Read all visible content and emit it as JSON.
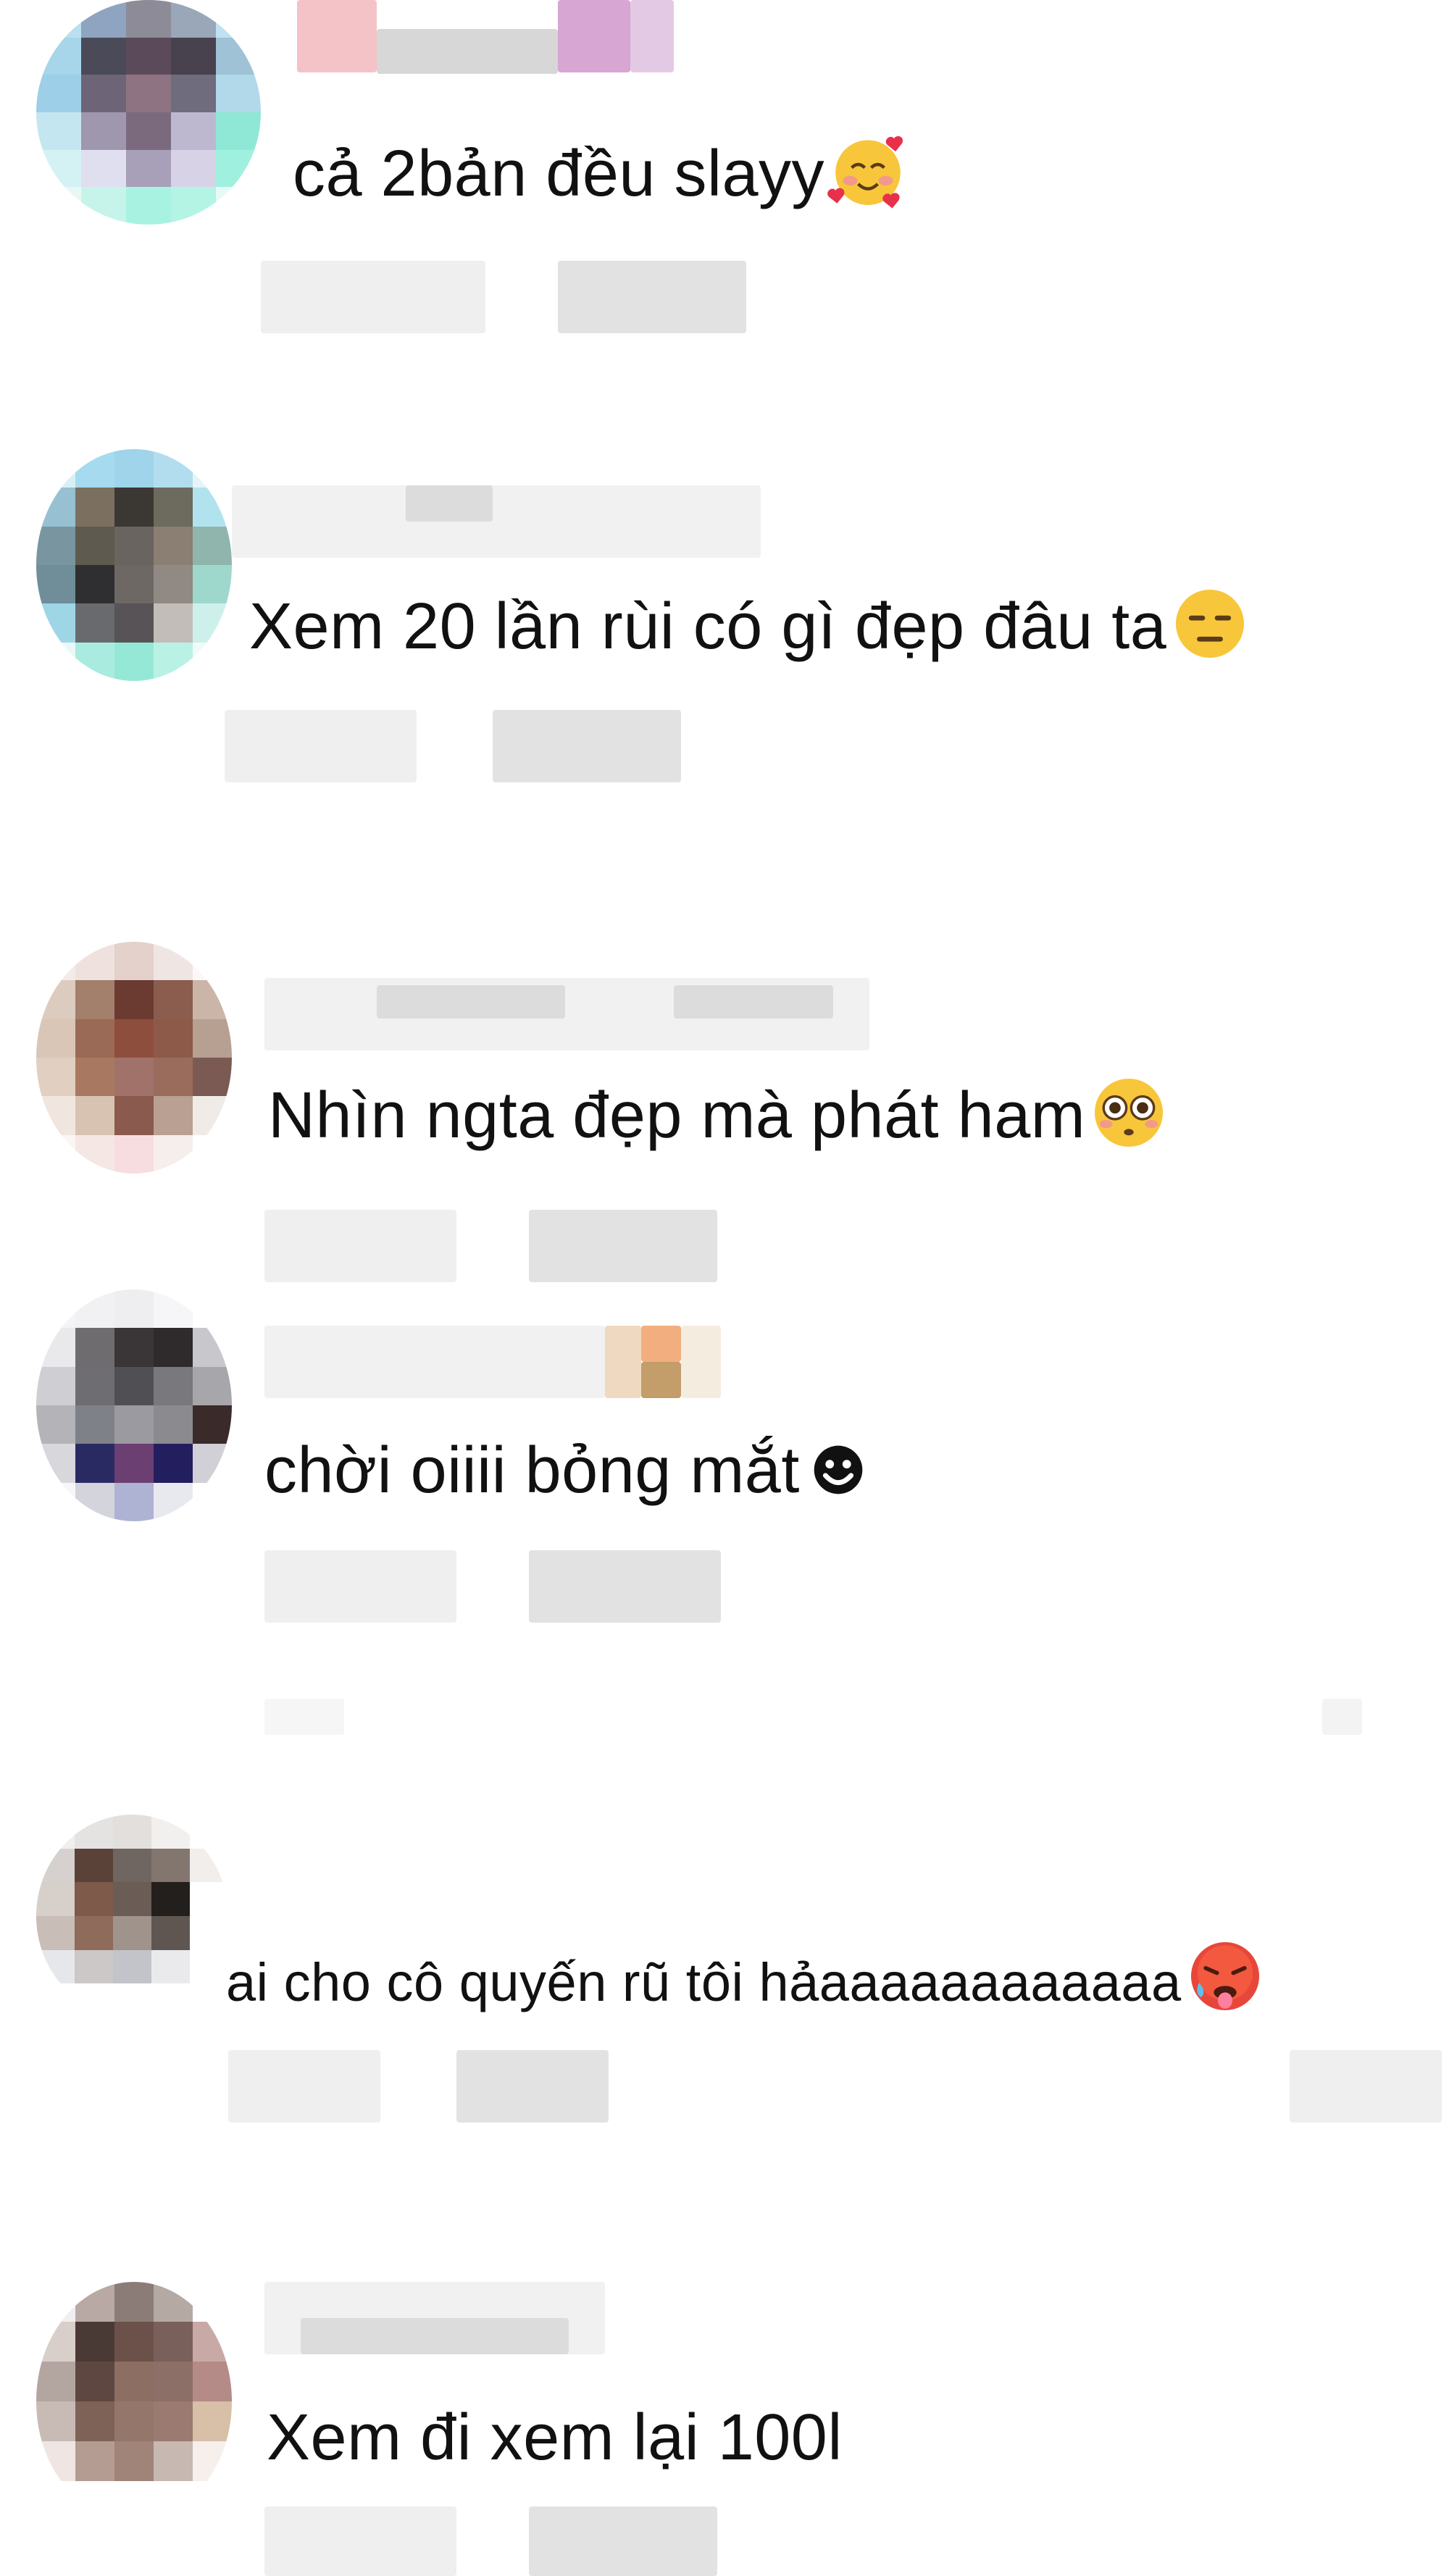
{
  "comments": [
    {
      "text": "cả 2bản đều slayy",
      "emoji": "smiling-face-with-hearts"
    },
    {
      "text": "Xem 20 lần rùi có gì đẹp đâu ta",
      "emoji": "expressionless-face"
    },
    {
      "text": "Nhìn ngta đẹp mà phát ham",
      "emoji": "flushed-face"
    },
    {
      "text": "chời oiiii bỏng mắt",
      "emoji": "smiling-face-glyph"
    },
    {
      "text": "ai cho cô quyến rũ tôi hảaaaaaaaaaaaa",
      "emoji": "hot-face"
    },
    {
      "text": "Xem đi xem lại 100l",
      "emoji": ""
    }
  ]
}
